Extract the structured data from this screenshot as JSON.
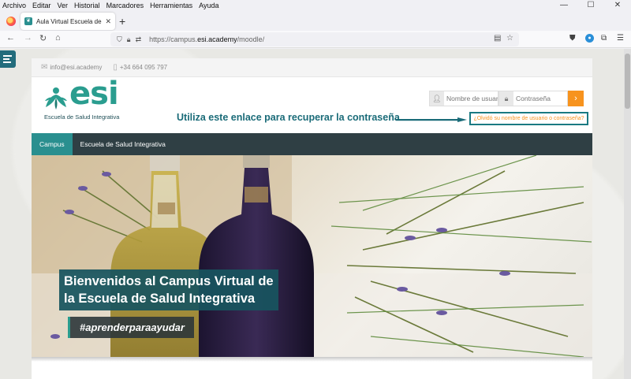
{
  "browser": {
    "menu": [
      "Archivo",
      "Editar",
      "Ver",
      "Historial",
      "Marcadores",
      "Herramientas",
      "Ayuda"
    ],
    "window_controls": [
      "—",
      "☐",
      "✕"
    ],
    "tab_title": "Aula Virtual Escuela de Salud In",
    "url_host": "https://campus.",
    "url_domain": "esi.academy",
    "url_path": "/moodle/"
  },
  "site": {
    "email": "info@esi.academy",
    "phone": "+34 664 095 797",
    "logo_word": "esi",
    "logo_sub": "Escuela de Salud Integrativa",
    "brand_color": "#2a9d8f",
    "accent_color": "#f7931e"
  },
  "login": {
    "username_placeholder": "Nombre de usuar",
    "password_placeholder": "Contraseña",
    "submit_icon": "›",
    "forgot_link": "¿Olvidó su nombre de usuario o contraseña?"
  },
  "annotation": {
    "text": "Utiliza este enlace para recuperar la contraseña"
  },
  "nav": {
    "items": [
      {
        "label": "Campus",
        "active": true
      },
      {
        "label": "Escuela de Salud Integrativa",
        "active": false
      }
    ]
  },
  "hero": {
    "title_line1": "Bienvenidos al Campus Virtual de",
    "title_line2": "la Escuela de Salud Integrativa",
    "tagline": "#aprenderparaayudar"
  }
}
